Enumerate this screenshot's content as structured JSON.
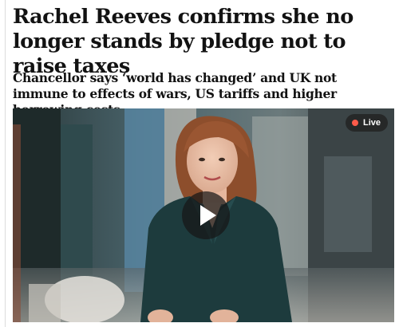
{
  "article": {
    "headline": "Rachel Reeves confirms she no longer stands by pledge not to raise taxes",
    "standfirst": "Chancellor says ‘world has changed’ and UK not immune to effects of wars, US tariffs and higher borrowing costs"
  },
  "video": {
    "live_label": "Live",
    "play_icon": "play-icon",
    "live_dot_color": "#ff5b4a"
  }
}
